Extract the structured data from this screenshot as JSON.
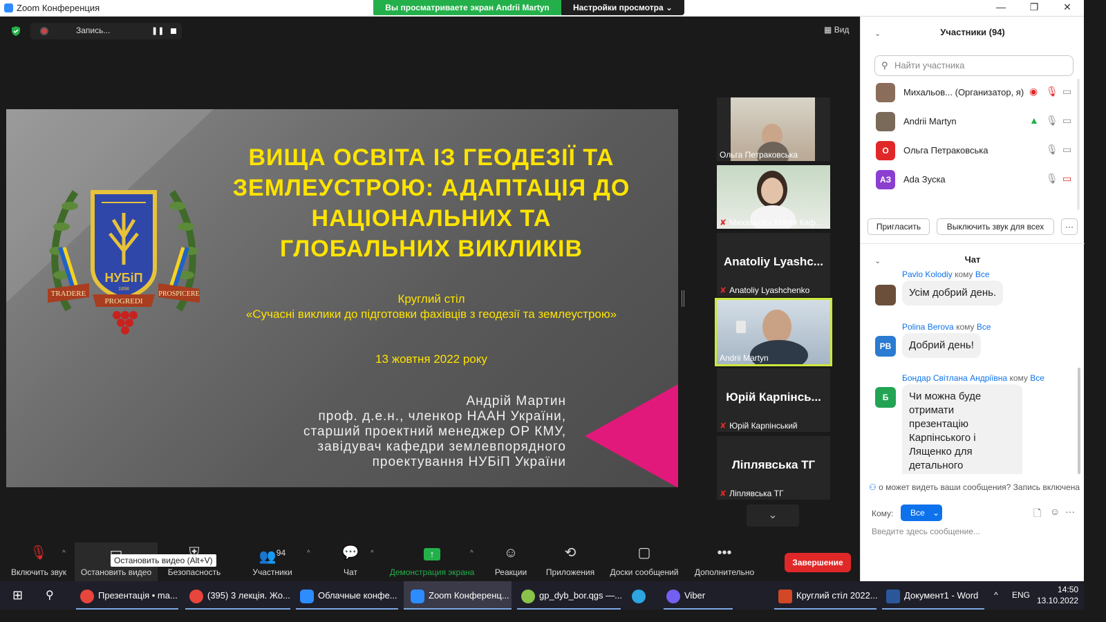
{
  "window": {
    "title": "Zoom Конференция",
    "share_banner": "Вы просматриваете экран Andrii Martyn",
    "view_settings": "Настройки просмотра",
    "minimize": "—",
    "restore": "❐",
    "close": "✕"
  },
  "recording": {
    "label": "Запись...",
    "pause": "❚❚"
  },
  "view_button": "Вид",
  "slide": {
    "title": "ВИЩА ОСВІТА ІЗ ГЕОДЕЗІЇ ТА ЗЕМЛЕУСТРОЮ: АДАПТАЦІЯ ДО НАЦІОНАЛЬНИХ ТА ГЛОБАЛЬНИХ ВИКЛИКІВ",
    "subtitle_1": "Круглий стіл",
    "subtitle_2": "«Сучасні виклики до підготовки фахівців з геодезії та землеустрою»",
    "date": "13 жовтня 2022 року",
    "author_name": "Андрій Мартин",
    "author_line_1": "проф. д.е.н., членкор НААН України,",
    "author_line_2": "старший проектний менеджер ОР КМУ,",
    "author_line_3": "завідувач кафедри землевпорядного",
    "author_line_4": "проектування НУБіП України",
    "crest": {
      "banner_left": "TRADERE",
      "banner_center": "PROGREDI",
      "banner_right": "PROSPICERE",
      "shield_text": "НУБіП",
      "year": "1898"
    }
  },
  "gallery": {
    "tiles": [
      {
        "name": "Ольга Петраковська"
      },
      {
        "name": "Михальова Марія Каф..."
      },
      {
        "big": "Anatoliy Lyashc...",
        "name": "Anatoliy Lyashchenko"
      },
      {
        "name": "Andrii Martyn"
      },
      {
        "big": "Юрій Карпінсь...",
        "name": "Юрій Карпінський"
      },
      {
        "big": "Ліплявська ТГ",
        "name": "Ліплявська ТГ"
      }
    ],
    "scroll_down": "⌄"
  },
  "toolbar": {
    "unmute": "Включить звук",
    "stop_video": "Остановить видео",
    "tooltip": "Остановить видео (Alt+V)",
    "security": "Безопасность",
    "participants": "Участники",
    "participants_count": "94",
    "chat": "Чат",
    "share_screen": "Демонстрация экрана",
    "reactions": "Реакции",
    "apps": "Приложения",
    "whiteboards": "Доски сообщений",
    "more": "Дополнительно",
    "end": "Завершение"
  },
  "participants_panel": {
    "title": "Участники (94)",
    "search_placeholder": "Найти участника",
    "list": [
      {
        "name": "Михальов...  (Организатор, я)",
        "initials": "",
        "color": "#8a6d5a"
      },
      {
        "name": "Andrii Martyn",
        "initials": "",
        "color": "#7a6a5a"
      },
      {
        "name": "Ольга Петраковська",
        "initials": "О",
        "color": "#e02828"
      },
      {
        "name": "Ada Зуска",
        "initials": "АЗ",
        "color": "#8a3fd1"
      }
    ],
    "invite": "Пригласить",
    "mute_all": "Выключить звук для всех",
    "more": "···"
  },
  "chat_panel": {
    "title": "Чат",
    "to_word": "кому",
    "messages": [
      {
        "sender": "Pavlo Kolodiy",
        "to": "Все",
        "text": "Усім добрий день.",
        "initials": "",
        "color": "#6b4f3a"
      },
      {
        "sender": "Polina Berova",
        "to": "Все",
        "text": "Добрий день!",
        "initials": "PB",
        "color": "#2a7bd1"
      },
      {
        "sender": "Бондар Світлана Андріївна",
        "to": "Все",
        "text": "Чи можна буде отримати презентацію Карпінського і Лященко для детального ознайомлення?",
        "initials": "Б",
        "color": "#23a455"
      }
    ],
    "notice": "о может видеть ваши сообщения? Запись включена",
    "to_label": "Кому:",
    "to_value": "Все",
    "input_placeholder": "Введите здесь сообщение..."
  },
  "taskbar": {
    "items": [
      {
        "label": "Презентація • ma...",
        "color": "#e8453c"
      },
      {
        "label": "(395) 3 лекція. Жо...",
        "color": "#e8453c"
      },
      {
        "label": "Облачные конфе...",
        "color": "#2d8cff"
      },
      {
        "label": "Zoom Конференц...",
        "color": "#2d8cff"
      },
      {
        "label": "gp_dyb_bor.qgs —...",
        "color": "#8bc34a"
      },
      {
        "label": "",
        "color": "#2ca5e0"
      },
      {
        "label": "Viber",
        "color": "#7360f2"
      },
      {
        "label": "Круглий стіл 2022...",
        "color": "#d24726"
      },
      {
        "label": "Документ1 - Word",
        "color": "#2b579a"
      }
    ],
    "lang": "ENG",
    "time": "14:50",
    "date": "13.10.2022"
  }
}
